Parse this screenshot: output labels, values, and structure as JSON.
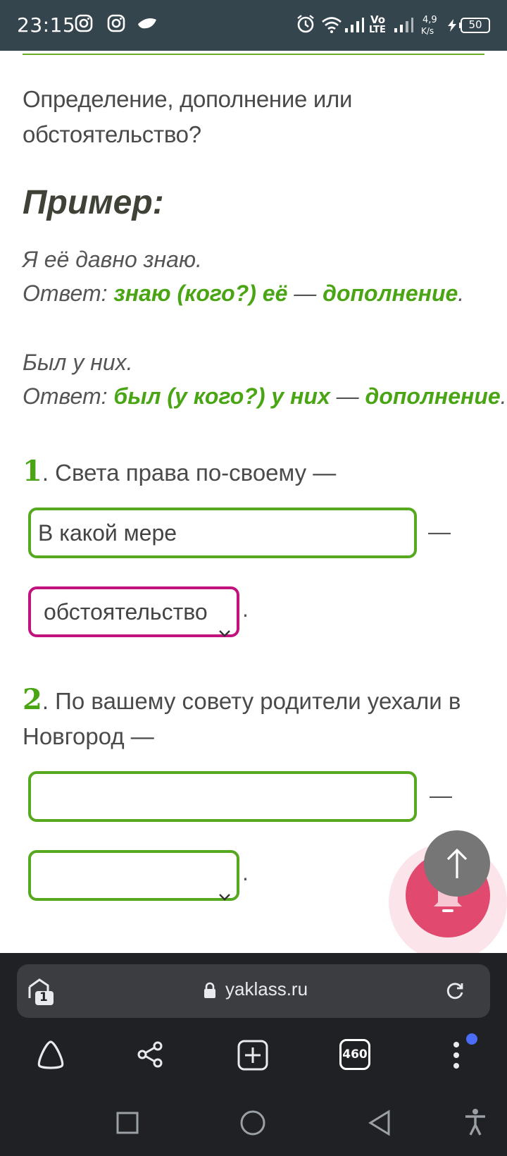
{
  "status_bar": {
    "time": "23:15",
    "net_speed_value": "4,9",
    "net_speed_unit": "K/s",
    "volte_top": "Vo",
    "volte_bottom": "LTE",
    "battery": "50"
  },
  "content": {
    "intro": "Определение, дополнение или обстоятельство?",
    "example_heading": "Пример:",
    "examples": [
      {
        "sentence": "Я её давно знаю.",
        "answer_prefix": "Ответ: ",
        "answer_phrase": "знаю (кого?) её",
        "dash": " — ",
        "answer_role": "дополнение",
        "end": "."
      },
      {
        "sentence": "Был у них.",
        "answer_prefix": "Ответ: ",
        "answer_phrase": "был (у кого?) у них",
        "dash": " — ",
        "answer_role": "дополнение",
        "end": "."
      }
    ],
    "questions": [
      {
        "number": "1",
        "text": ". Света права по-своему —",
        "input_value": "В какой мере",
        "select_value": "обстоятельство"
      },
      {
        "number": "2",
        "text": ". По вашему совету родители уехали в Новгород —",
        "input_value": "",
        "select_value": ""
      }
    ],
    "dash": "—",
    "period": "."
  },
  "browser": {
    "url": "yaklass.ru",
    "tab_count": "460",
    "tab_group_badge": "1"
  },
  "colors": {
    "accent_green": "#4aa514",
    "select_pink": "#c2127d",
    "status_bar_bg": "#35454d",
    "browser_bg": "#202124"
  }
}
